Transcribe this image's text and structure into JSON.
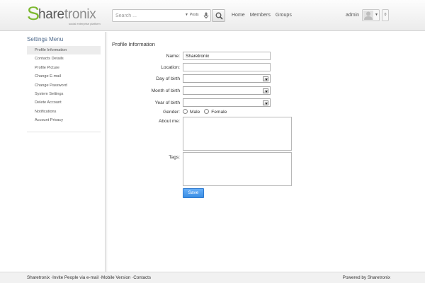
{
  "header": {
    "logo": {
      "text_main": "hare",
      "text_accent": "tronix",
      "s": "S",
      "tagline": "social enterprise platform"
    },
    "search": {
      "placeholder": "Search ...",
      "scope": "Posts"
    },
    "nav": [
      "Home",
      "Members",
      "Groups"
    ],
    "user": {
      "name": "admin",
      "count": "0"
    }
  },
  "sidebar": {
    "title": "Settings Menu",
    "items": [
      {
        "label": "Profile Information",
        "active": true
      },
      {
        "label": "Contacts Details",
        "active": false
      },
      {
        "label": "Profile Picture",
        "active": false
      },
      {
        "label": "Change E-mail",
        "active": false
      },
      {
        "label": "Change Password",
        "active": false
      },
      {
        "label": "System Settings",
        "active": false
      },
      {
        "label": "Delete Account",
        "active": false
      },
      {
        "label": "Notifications",
        "active": false
      },
      {
        "label": "Account Privacy",
        "active": false
      }
    ]
  },
  "form": {
    "title": "Profile Information",
    "name_label": "Name:",
    "name_value": "Sharetronix",
    "location_label": "Location:",
    "location_value": "",
    "day_label": "Day of birth",
    "month_label": "Month of birth",
    "year_label": "Year of birth",
    "gender_label": "Gender:",
    "gender_male": "Male",
    "gender_female": "Female",
    "about_label": "About me:",
    "tags_label": "Tags:",
    "save_label": "Save"
  },
  "footer": {
    "links": [
      "Sharetronix",
      "Invite People via e-mail",
      "Mobile Version",
      "Contacts"
    ],
    "powered": "Powered by Sharetronix"
  },
  "colors": {
    "accent_green": "#7cb82f",
    "button_blue": "#4a9cf0",
    "sidebar_title": "#4e6a8c"
  }
}
